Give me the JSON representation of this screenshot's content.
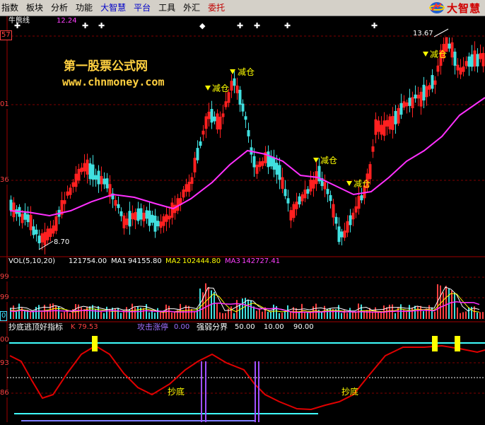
{
  "menu": [
    {
      "label": "指数",
      "style": "normal"
    },
    {
      "label": "板块",
      "style": "normal"
    },
    {
      "label": "分析",
      "style": "normal"
    },
    {
      "label": "功能",
      "style": "normal"
    },
    {
      "label": "大智慧",
      "style": "blue"
    },
    {
      "label": "平台",
      "style": "blue"
    },
    {
      "label": "工具",
      "style": "normal"
    },
    {
      "label": "外汇",
      "style": "normal"
    },
    {
      "label": "委托",
      "style": "red"
    }
  ],
  "brand": {
    "name": "大智慧"
  },
  "main_panel": {
    "indicator_name": "牛熊线",
    "indicator_value": "12.24",
    "axis_labels": [
      "57",
      "01",
      "36"
    ],
    "high_label": "13.67",
    "low_label": "8.70",
    "signal_label": "减仓",
    "watermark_cn": "第一股票公式网",
    "watermark_url": "www.chnmoney.com"
  },
  "vol_panel": {
    "title": "VOL(5,10,20)",
    "vol_value": "121754.00",
    "ma1_label": "MA1",
    "ma1_value": "94155.80",
    "ma2_label": "MA2",
    "ma2_value": "102444.80",
    "ma3_label": "MA3",
    "ma3_value": "142727.41",
    "axis_labels": [
      "99",
      "99",
      "0"
    ]
  },
  "ind_panel": {
    "title": "抄底逃顶好指标",
    "k_label": "K",
    "k_value": "79.53",
    "attack_label": "攻击涨停",
    "attack_value": "0.00",
    "strength_label": "强弱分界",
    "strength_value": "50.00",
    "v2": "10.00",
    "v3": "90.00",
    "axis_labels": [
      "00",
      "93",
      "86"
    ],
    "bottom_label": "抄底"
  },
  "colors": {
    "up": "#ff2020",
    "down": "#40e0e0",
    "ma_line": "#ff30ff",
    "menubar": "#d4d0c8",
    "signal": "#ffff00",
    "kline": "#e00000"
  }
}
